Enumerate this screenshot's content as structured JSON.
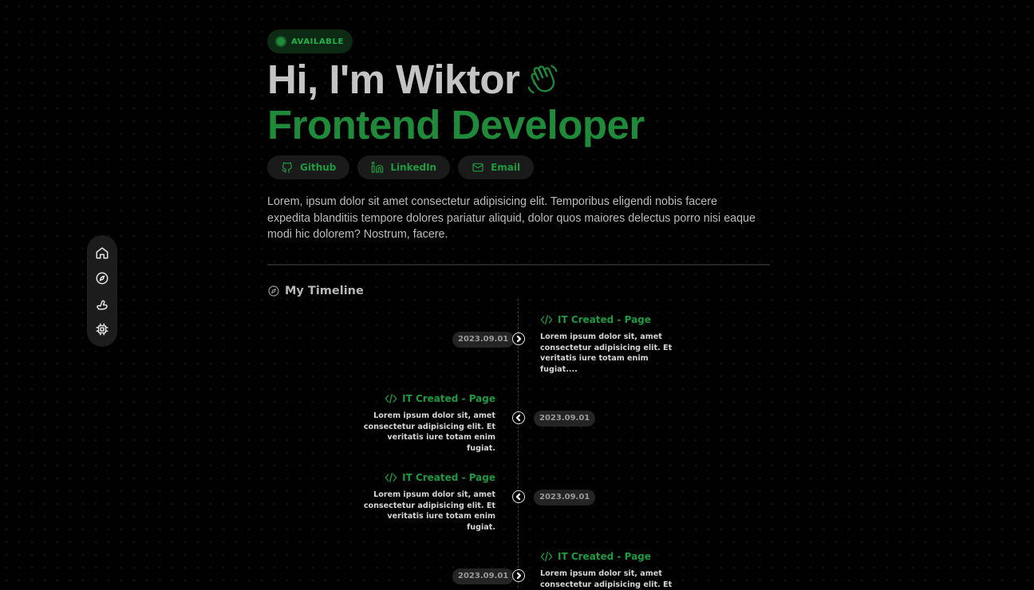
{
  "status": {
    "label": "AVAILABLE"
  },
  "hero": {
    "greeting": "Hi, I'm Wiktor",
    "role": "Frontend Developer"
  },
  "socials": [
    {
      "label": "Github",
      "icon": "github-icon"
    },
    {
      "label": "LinkedIn",
      "icon": "linkedin-icon"
    },
    {
      "label": "Email",
      "icon": "mail-icon"
    }
  ],
  "intro": "Lorem, ipsum dolor sit amet consectetur adipisicing elit. Temporibus eligendi nobis facere expedita blanditiis tempore dolores pariatur aliquid, dolor quos maiores delectus porro nisi eaque modi hic dolorem? Nostrum, facere.",
  "timeline": {
    "heading": "My Timeline",
    "items": [
      {
        "title": "IT Created - Page",
        "text": "Lorem ipsum dolor sit, amet consectetur adipisicing elit. Et veritatis iure totam enim fugiat....",
        "date": "2023.09.01",
        "side": "right"
      },
      {
        "title": "IT Created - Page",
        "text": "Lorem ipsum dolor sit, amet consectetur adipisicing elit. Et veritatis iure totam enim fugiat.",
        "date": "2023.09.01",
        "side": "left"
      },
      {
        "title": "IT Created - Page",
        "text": "Lorem ipsum dolor sit, amet consectetur adipisicing elit. Et veritatis iure totam enim fugiat.",
        "date": "2023.09.01",
        "side": "left"
      },
      {
        "title": "IT Created - Page",
        "text": "Lorem ipsum dolor sit, amet consectetur adipisicing elit. Et",
        "date": "2023.09.01",
        "side": "right"
      }
    ]
  },
  "nav": [
    {
      "icon": "home-icon"
    },
    {
      "icon": "compass-icon"
    },
    {
      "icon": "hand-icon"
    },
    {
      "icon": "chip-icon"
    }
  ],
  "colors": {
    "accent": "#1f8a3a",
    "background": "#000000"
  }
}
